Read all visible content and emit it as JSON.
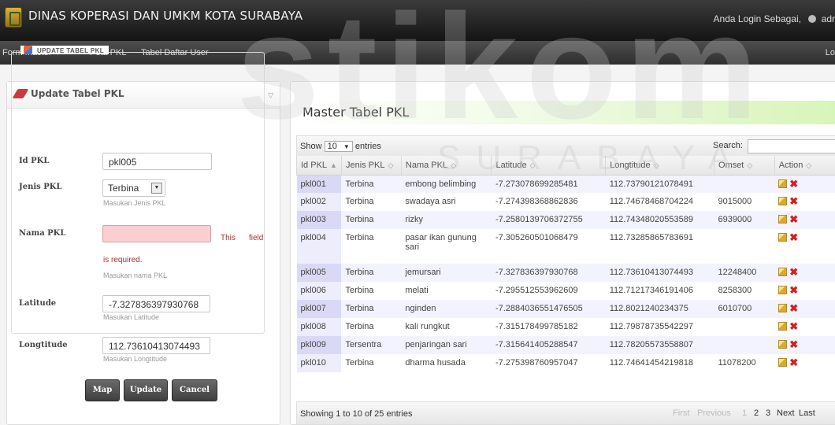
{
  "app": {
    "title": "DINAS KOPERASI DAN UMKM KOTA SURABAYA",
    "login_text": "Anda Login Sebagai,",
    "user": "adr"
  },
  "nav": {
    "form_master": "Form Master",
    "peta_pkl": "Peta PKL",
    "tabel_user": "Tabel Daftar User",
    "logout": "Lo"
  },
  "left_panel": {
    "title": "Update Tabel PKL",
    "legend": "UPDATE TABEL PKL",
    "fields": {
      "id_label": "Id PKL",
      "id_value": "pkl005",
      "jenis_label": "Jenis PKL",
      "jenis_value": "Terbina",
      "jenis_help": "Masukan Jenis PKL",
      "nama_label": "Nama PKL",
      "nama_value": "",
      "nama_error_a": "This",
      "nama_error_b": "field",
      "nama_error_c": "is required.",
      "nama_help": "Masukan nama PKL",
      "lat_label": "Latitude",
      "lat_value": "-7.327836397930768",
      "lat_help": "Masukan Latitude",
      "lng_label": "Longtitude",
      "lng_value": "112.73610413074493",
      "lng_help": "Masukan Longtitude"
    },
    "buttons": {
      "map": "Map",
      "update": "Update",
      "cancel": "Cancel"
    }
  },
  "right_panel": {
    "title": "Master Tabel PKL",
    "show_label": "Show",
    "show_value": "10",
    "entries_label": "entries",
    "search_label": "Search:",
    "columns": [
      "Id PKL",
      "Jenis PKL",
      "Nama PKL",
      "Latitude",
      "Longtitude",
      "Omset",
      "Action"
    ],
    "rows": [
      {
        "id": "pkl001",
        "jenis": "Terbina",
        "nama": "embong belimbing",
        "lat": "-7.273078699285481",
        "lng": "112.73790121078491",
        "omset": ""
      },
      {
        "id": "pkl002",
        "jenis": "Terbina",
        "nama": "swadaya asri",
        "lat": "-7.274398368862836",
        "lng": "112.74678468704224",
        "omset": "9015000"
      },
      {
        "id": "pkl003",
        "jenis": "Terbina",
        "nama": "rizky",
        "lat": "-7.2580139706372755",
        "lng": "112.74348020553589",
        "omset": "6939000"
      },
      {
        "id": "pkl004",
        "jenis": "Terbina",
        "nama": "pasar ikan gunung sari",
        "lat": "-7.305260501068479",
        "lng": "112.73285865783691",
        "omset": ""
      },
      {
        "id": "pkl005",
        "jenis": "Terbina",
        "nama": "jemursari",
        "lat": "-7.327836397930768",
        "lng": "112.73610413074493",
        "omset": "12248400"
      },
      {
        "id": "pkl006",
        "jenis": "Terbina",
        "nama": "melati",
        "lat": "-7.295512553962609",
        "lng": "112.71217346191406",
        "omset": "8258300"
      },
      {
        "id": "pkl007",
        "jenis": "Terbina",
        "nama": "nginden",
        "lat": "-7.2884036551476505",
        "lng": "112.8021240234375",
        "omset": "6010700"
      },
      {
        "id": "pkl008",
        "jenis": "Terbina",
        "nama": "kali rungkut",
        "lat": "-7.315178499785182",
        "lng": "112.79878735542297",
        "omset": ""
      },
      {
        "id": "pkl009",
        "jenis": "Tersentra",
        "nama": "penjaringan sari",
        "lat": "-7.315641405288547",
        "lng": "112.78205573558807",
        "omset": ""
      },
      {
        "id": "pkl010",
        "jenis": "Terbina",
        "nama": "dharma husada",
        "lat": "-7.275398760957047",
        "lng": "112.74641454219818",
        "omset": "11078200"
      }
    ],
    "info": "Showing 1 to 10 of 25 entries",
    "pager": {
      "first": "First",
      "previous": "Previous",
      "p1": "1",
      "p2": "2",
      "p3": "3",
      "next": "Next",
      "last": "Last"
    }
  },
  "watermark": {
    "big": "stikom",
    "small": "SURABAYA"
  }
}
